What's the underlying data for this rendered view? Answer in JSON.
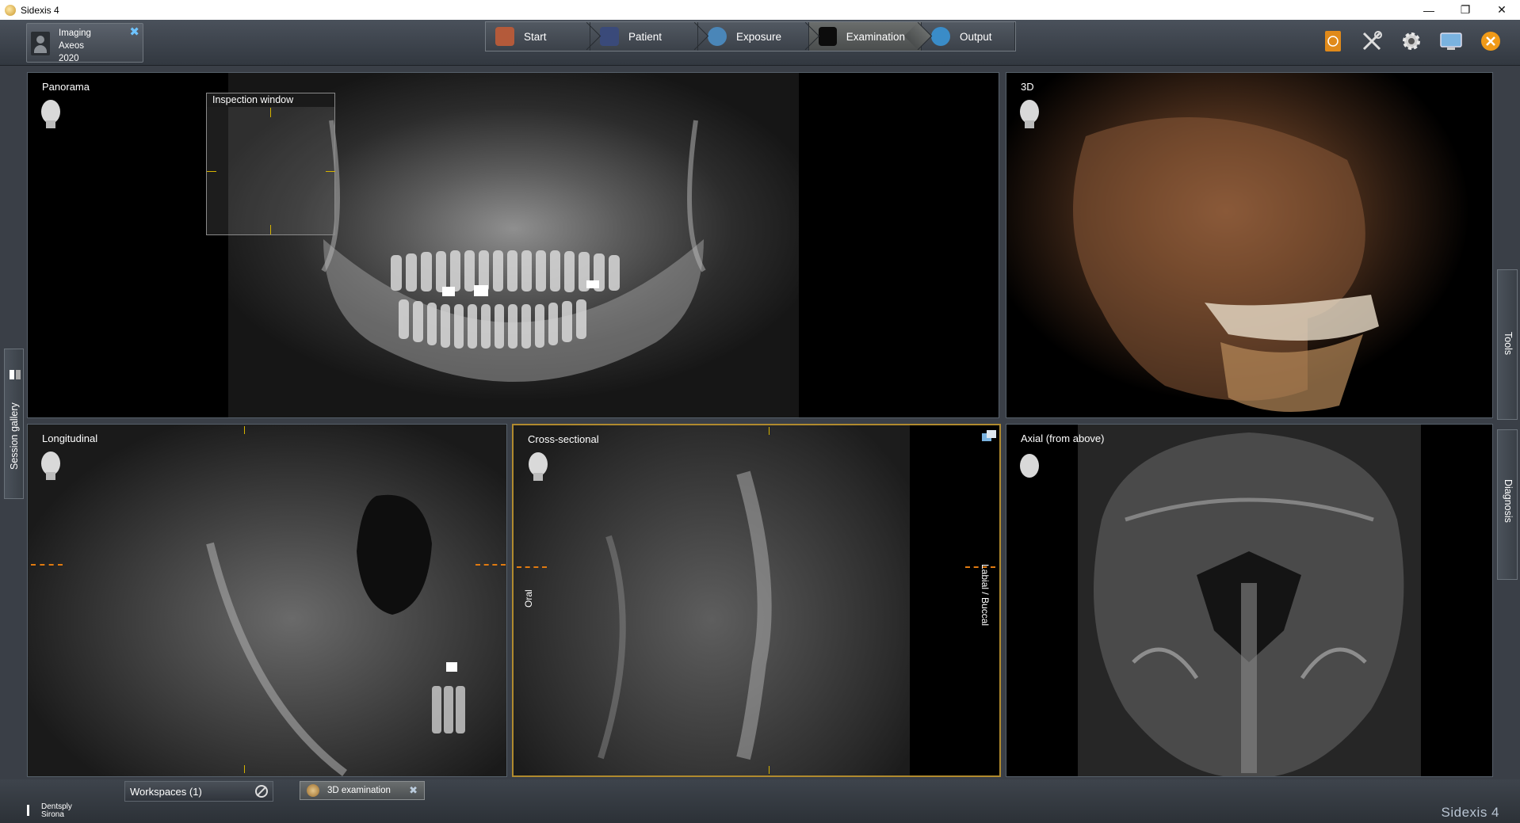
{
  "window": {
    "title": "Sidexis 4",
    "controls": {
      "minimize": "—",
      "restore": "❐",
      "close": "✕"
    }
  },
  "session_tile": {
    "label": "Imaging\nAxeos\n2020",
    "pin_icon": "pin-icon"
  },
  "nav_steps": [
    {
      "label": "Start",
      "icon": "house-icon",
      "color": "#b45a3a"
    },
    {
      "label": "Patient",
      "icon": "person-icon",
      "color": "#3a4a7a"
    },
    {
      "label": "Exposure",
      "icon": "exposure-icon",
      "color": "#4a86b8"
    },
    {
      "label": "Examination",
      "icon": "examination-icon",
      "color": "#0c0c0c",
      "active": true
    },
    {
      "label": "Output",
      "icon": "globe-icon",
      "color": "#3a8cc8"
    }
  ],
  "toolbar_icons": [
    {
      "name": "bookmark-icon",
      "color": "#e08a1a"
    },
    {
      "name": "tools-icon",
      "color": "#dddddd"
    },
    {
      "name": "gear-icon",
      "color": "#dddddd"
    },
    {
      "name": "monitor-icon",
      "color": "#7ab3e0"
    },
    {
      "name": "close-app-icon",
      "color": "#f09a18"
    }
  ],
  "views": {
    "panorama": {
      "label": "Panorama",
      "inspection_window": "Inspection window"
    },
    "three_d": {
      "label": "3D"
    },
    "longitudinal": {
      "label": "Longitudinal"
    },
    "cross_sectional": {
      "label": "Cross-sectional",
      "left_label": "Oral",
      "right_label": "Labial / Buccal"
    },
    "axial": {
      "label": "Axial (from above)"
    }
  },
  "side_tabs": {
    "session_gallery": "Session gallery",
    "tools": "Tools",
    "diagnosis": "Diagnosis"
  },
  "bottom": {
    "workspaces": "Workspaces (1)",
    "tab": "3D examination",
    "brand": "Dentsply\nSirona",
    "product": "Sidexis 4"
  },
  "colors": {
    "accent_selected": "#b08a2e",
    "crosshair": "#d6b300",
    "slice_line": "#e07a10",
    "volume_tint": "#8a5a3a"
  }
}
